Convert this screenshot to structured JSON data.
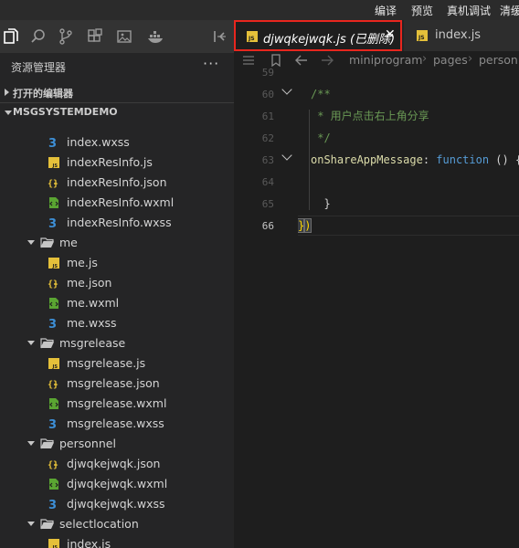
{
  "toolbar": {
    "compile": "编译",
    "preview": "预览",
    "remote_debug": "真机调试",
    "clear": "清缓"
  },
  "activity_icons": [
    "files-icon",
    "search-icon",
    "source-control-icon",
    "extensions-icon",
    "image-icon",
    "docker-icon",
    "split-icon"
  ],
  "sidebar": {
    "title": "资源管理器",
    "more": "···",
    "open_editors": "打开的编辑器",
    "project": "MSGSYSTEMDEMO",
    "tree": [
      {
        "type": "file",
        "kind": "wxss",
        "name": "index.wxss"
      },
      {
        "type": "file",
        "kind": "js",
        "name": "indexResInfo.js"
      },
      {
        "type": "file",
        "kind": "json",
        "name": "indexResInfo.json"
      },
      {
        "type": "file",
        "kind": "wxml",
        "name": "indexResInfo.wxml"
      },
      {
        "type": "file",
        "kind": "wxss",
        "name": "indexResInfo.wxss"
      },
      {
        "type": "folder",
        "name": "me"
      },
      {
        "type": "file",
        "kind": "js",
        "name": "me.js"
      },
      {
        "type": "file",
        "kind": "json",
        "name": "me.json"
      },
      {
        "type": "file",
        "kind": "wxml",
        "name": "me.wxml"
      },
      {
        "type": "file",
        "kind": "wxss",
        "name": "me.wxss"
      },
      {
        "type": "folder",
        "name": "msgrelease"
      },
      {
        "type": "file",
        "kind": "js",
        "name": "msgrelease.js"
      },
      {
        "type": "file",
        "kind": "json",
        "name": "msgrelease.json"
      },
      {
        "type": "file",
        "kind": "wxml",
        "name": "msgrelease.wxml"
      },
      {
        "type": "file",
        "kind": "wxss",
        "name": "msgrelease.wxss"
      },
      {
        "type": "folder",
        "name": "personnel"
      },
      {
        "type": "file",
        "kind": "json",
        "name": "djwqkejwqk.json"
      },
      {
        "type": "file",
        "kind": "wxml",
        "name": "djwqkejwqk.wxml"
      },
      {
        "type": "file",
        "kind": "wxss",
        "name": "djwqkejwqk.wxss"
      },
      {
        "type": "folder",
        "name": "selectlocation"
      },
      {
        "type": "file",
        "kind": "js",
        "name": "index.js"
      }
    ]
  },
  "tabs": [
    {
      "label": "djwqkejwqk.js (已删除)",
      "active": true,
      "deleted": true,
      "close": "✕"
    },
    {
      "label": "index.js",
      "active": false
    }
  ],
  "breadcrumb": [
    "miniprogram",
    "pages",
    "personn"
  ],
  "editor": {
    "current_line": 66,
    "lines": [
      {
        "num": "59",
        "text": ""
      },
      {
        "num": "60",
        "text": "/**"
      },
      {
        "num": "61",
        "text": " * 用户点击右上角分享"
      },
      {
        "num": "62",
        "text": " */"
      },
      {
        "num": "63",
        "text": "onShareAppMessage: function () {"
      },
      {
        "num": "64",
        "text": ""
      },
      {
        "num": "65",
        "text": "  }"
      },
      {
        "num": "66",
        "text": "})"
      }
    ]
  },
  "colors": {
    "js_badge": "#e5c03a",
    "json_badge": "#e5c03a",
    "wxml_badge": "#5aa532",
    "wxss_badge": "#3d8fd6",
    "highlight_border": "#e8261e",
    "comment": "#6a9955",
    "function_name": "#dcdcaa",
    "keyword": "#569cd6"
  }
}
